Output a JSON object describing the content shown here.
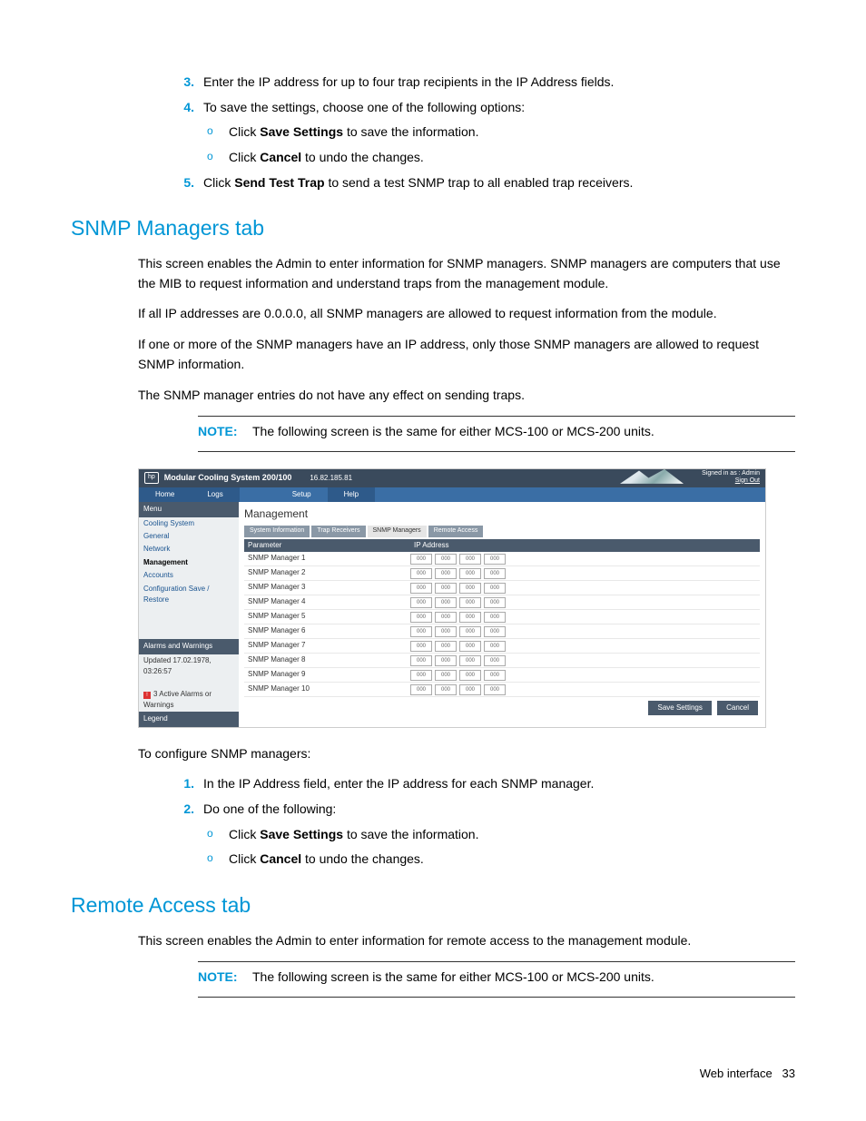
{
  "steps_top": [
    {
      "n": "3.",
      "t_pre": "Enter the IP address for up to four trap recipients in the IP Address fields."
    },
    {
      "n": "4.",
      "t_pre": "To save the settings, choose one of the following options:"
    }
  ],
  "sub4": [
    {
      "pre": "Click ",
      "bold": "Save Settings",
      "post": " to save the information."
    },
    {
      "pre": "Click ",
      "bold": "Cancel",
      "post": " to undo the changes."
    }
  ],
  "step5": {
    "n": "5.",
    "pre": "Click ",
    "bold": "Send Test Trap",
    "post": " to send a test SNMP trap to all enabled trap receivers."
  },
  "h_snmp": "SNMP Managers tab",
  "p1": "This screen enables the Admin to enter information for SNMP managers. SNMP managers are computers that use the MIB to request information and understand traps from the management module.",
  "p2": "If all IP addresses are 0.0.0.0, all SNMP managers are allowed to request information from the module.",
  "p3": "If one or more of the SNMP managers have an IP address, only those SNMP managers are allowed to request SNMP information.",
  "p4": "The SNMP manager entries do not have any effect on sending traps.",
  "note_lbl": "NOTE:",
  "note1": "The following screen is the same for either MCS-100 or MCS-200 units.",
  "shot": {
    "title": "Modular Cooling System 200/100",
    "ip": "16.82.185.81",
    "signed": "Signed in as : Admin",
    "signout": "Sign Out",
    "tabs": [
      "Home",
      "Logs",
      "Setup",
      "Help"
    ],
    "side_menu_hdr": "Menu",
    "side": [
      "Cooling System",
      "General",
      "Network",
      "Management",
      "Accounts",
      "Configuration Save / Restore"
    ],
    "side_management_idx": 3,
    "alarm_hdr": "Alarms and Warnings",
    "alarm_upd": "Updated 17.02.1978, 03:26:57",
    "alarm_line": "3 Active Alarms or Warnings",
    "legend_hdr": "Legend",
    "main_title": "Management",
    "subtabs": [
      "System Information",
      "Trap Receivers",
      "SNMP Managers",
      "Remote Access"
    ],
    "col1": "Parameter",
    "col2": "IP Address",
    "rows": [
      "SNMP Manager 1",
      "SNMP Manager 2",
      "SNMP Manager 3",
      "SNMP Manager 4",
      "SNMP Manager 5",
      "SNMP Manager 6",
      "SNMP Manager 7",
      "SNMP Manager 8",
      "SNMP Manager 9",
      "SNMP Manager 10"
    ],
    "octet": "000",
    "save": "Save Settings",
    "cancel": "Cancel"
  },
  "p_conf": "To configure SNMP managers:",
  "steps_conf": [
    {
      "n": "1.",
      "t": "In the IP Address field, enter the IP address for each SNMP manager."
    },
    {
      "n": "2.",
      "t": "Do one of the following:"
    }
  ],
  "sub_conf": [
    {
      "pre": "Click ",
      "bold": "Save Settings",
      "post": " to save the information."
    },
    {
      "pre": "Click ",
      "bold": "Cancel",
      "post": " to undo the changes."
    }
  ],
  "h_remote": "Remote Access tab",
  "p_remote": "This screen enables the Admin to enter information for remote access to the management module.",
  "note2": "The following screen is the same for either MCS-100 or MCS-200 units.",
  "footer_section": "Web interface",
  "footer_page": "33"
}
